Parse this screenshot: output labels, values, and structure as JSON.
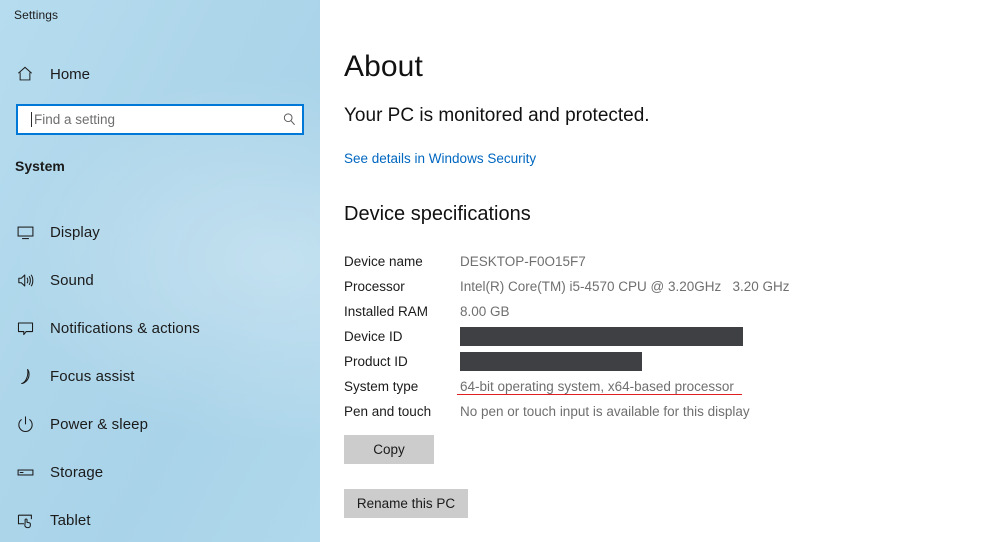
{
  "window": {
    "title": "Settings"
  },
  "sidebar": {
    "home": {
      "label": "Home",
      "icon": "home-icon"
    },
    "search": {
      "placeholder": "Find a setting",
      "value": "",
      "icon": "search-icon"
    },
    "group_title": "System",
    "items": [
      {
        "label": "Display",
        "icon": "monitor-icon"
      },
      {
        "label": "Sound",
        "icon": "speaker-icon"
      },
      {
        "label": "Notifications & actions",
        "icon": "notification-balloon-icon"
      },
      {
        "label": "Focus assist",
        "icon": "moon-icon"
      },
      {
        "label": "Power & sleep",
        "icon": "power-icon"
      },
      {
        "label": "Storage",
        "icon": "drive-icon"
      },
      {
        "label": "Tablet",
        "icon": "tablet-hand-icon"
      }
    ]
  },
  "main": {
    "page_title": "About",
    "subtitle": "Your PC is monitored and protected.",
    "security_link": "See details in Windows Security",
    "section_heading": "Device specifications",
    "specs": [
      {
        "label": "Device name",
        "value": "DESKTOP-F0O15F7",
        "redacted": false,
        "underlined": false
      },
      {
        "label": "Processor",
        "value": "Intel(R) Core(TM) i5-4570 CPU @ 3.20GHz   3.20 GHz",
        "redacted": false,
        "underlined": false
      },
      {
        "label": "Installed RAM",
        "value": "8.00 GB",
        "redacted": false,
        "underlined": false
      },
      {
        "label": "Device ID",
        "value": "",
        "redacted": true,
        "redact_width": 283,
        "underlined": false
      },
      {
        "label": "Product ID",
        "value": "",
        "redacted": true,
        "redact_width": 182,
        "underlined": false
      },
      {
        "label": "System type",
        "value": "64-bit operating system, x64-based processor",
        "redacted": false,
        "underlined": true
      },
      {
        "label": "Pen and touch",
        "value": "No pen or touch input is available for this display",
        "redacted": false,
        "underlined": false
      }
    ],
    "copy_button": "Copy",
    "rename_button": "Rename this PC"
  },
  "colors": {
    "sidebar_blue": "#aed6ea",
    "accent_blue": "#0078d7",
    "link_blue": "#0067c0",
    "redaction_gray": "#3e4044",
    "button_gray": "#cccccc",
    "annotation_red": "#e02020",
    "value_gray": "#6f6f6f"
  }
}
